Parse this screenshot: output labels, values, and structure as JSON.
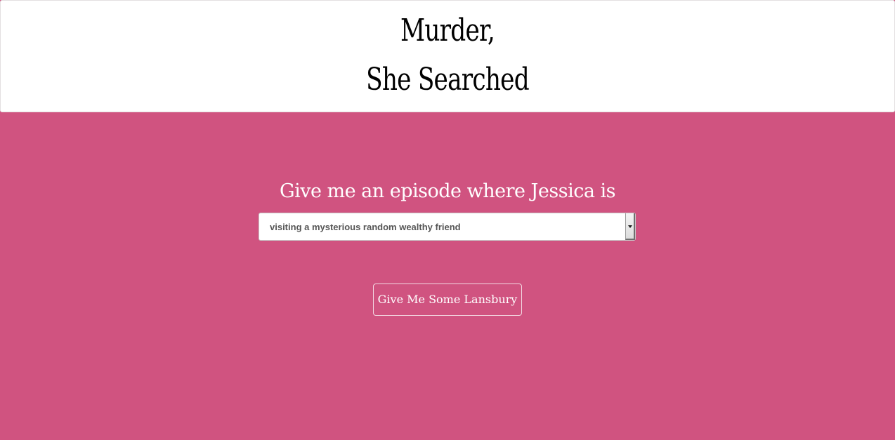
{
  "header": {
    "title_line1": "Murder,",
    "title_line2": "She Searched"
  },
  "main": {
    "prompt": "Give me an episode where Jessica is",
    "select": {
      "selected_value": "visiting a mysterious random wealthy friend"
    },
    "submit_label": "Give Me Some Lansbury"
  },
  "colors": {
    "background": "#d05380",
    "header_background": "#ffffff",
    "text_on_background": "#ffffff"
  }
}
